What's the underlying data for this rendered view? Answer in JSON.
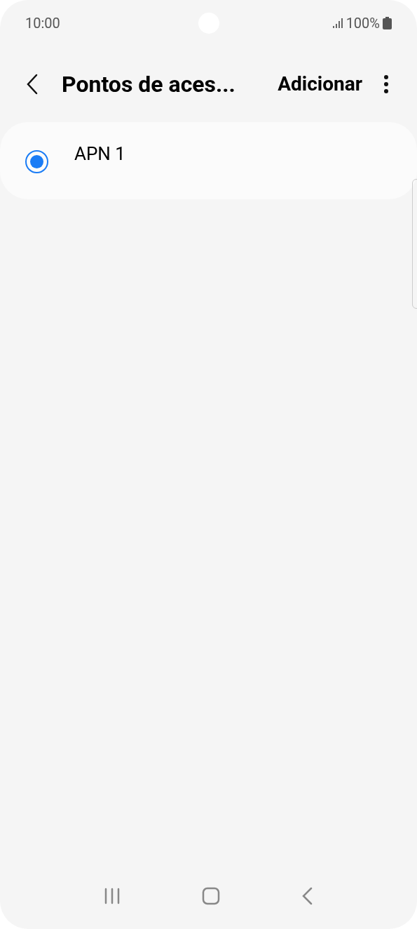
{
  "status_bar": {
    "time": "10:00",
    "battery": "100%"
  },
  "header": {
    "title": "Pontos de aces...",
    "action": "Adicionar"
  },
  "apns": [
    {
      "name": "APN 1",
      "selected": true
    }
  ]
}
